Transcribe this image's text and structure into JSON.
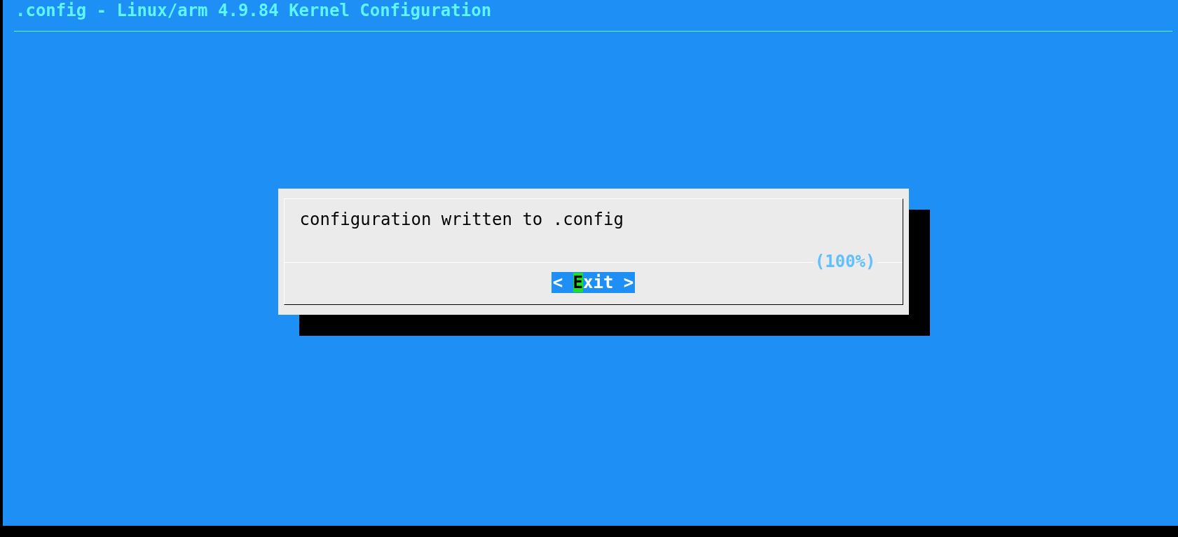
{
  "window": {
    "title": ".config - Linux/arm 4.9.84 Kernel Configuration"
  },
  "dialog": {
    "message": "configuration written to .config",
    "progress": "(100%)",
    "buttons": [
      {
        "left": "<",
        "hotkey": "E",
        "rest": "xit",
        "right": ">",
        "selected": true
      }
    ]
  }
}
